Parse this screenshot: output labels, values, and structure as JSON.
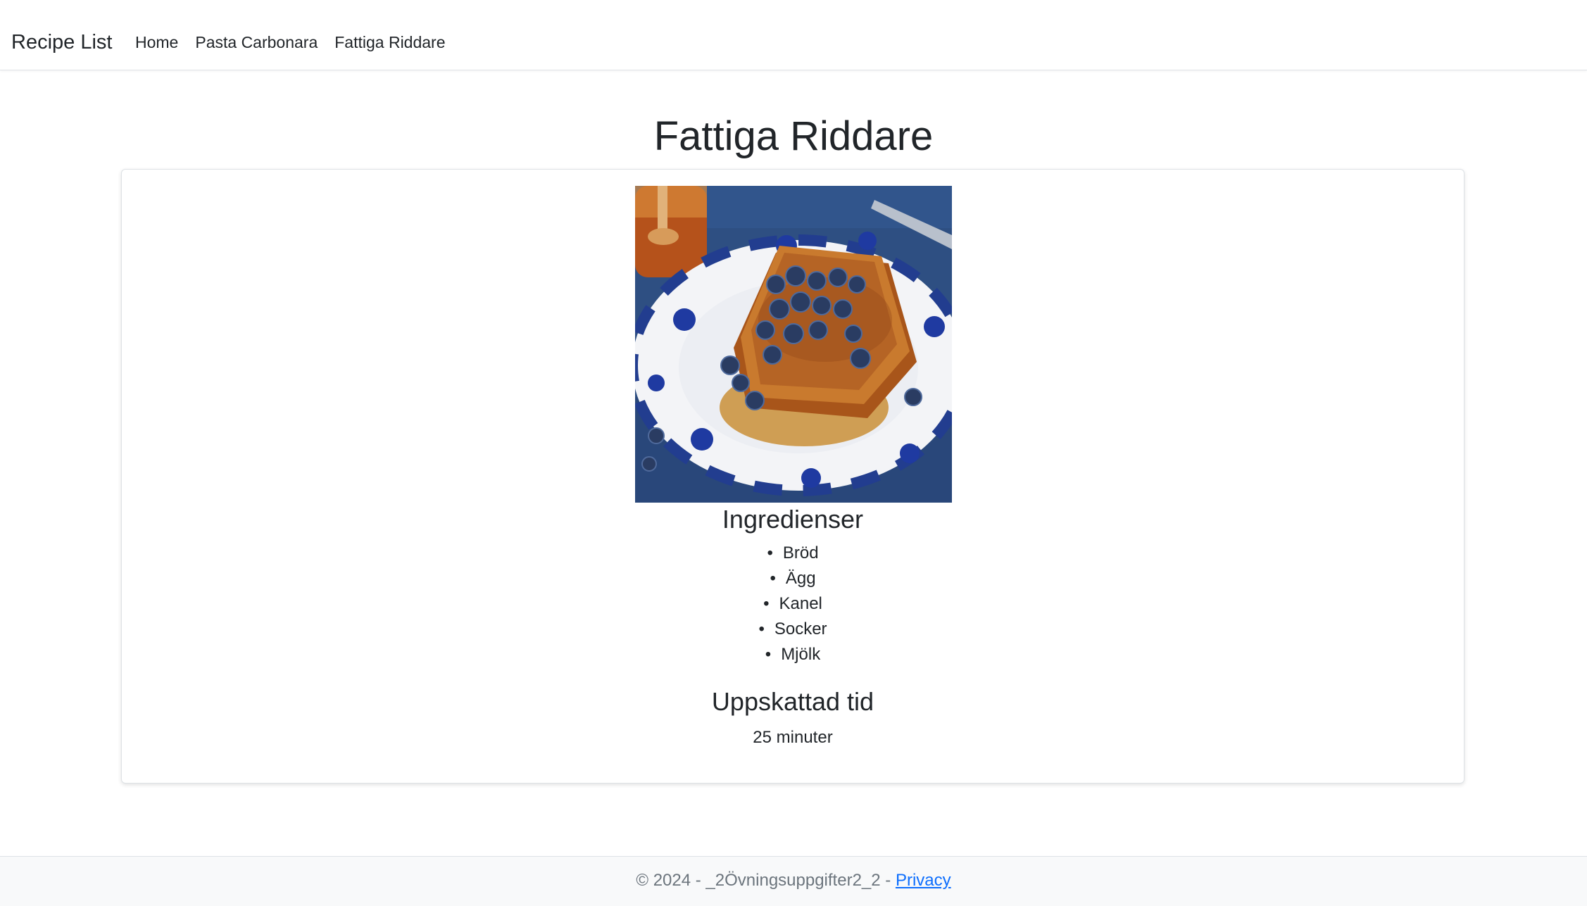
{
  "navbar": {
    "brand": "Recipe List",
    "links": [
      {
        "label": "Home"
      },
      {
        "label": "Pasta Carbonara"
      },
      {
        "label": "Fattiga Riddare"
      }
    ]
  },
  "recipe": {
    "title": "Fattiga Riddare",
    "ingredients_heading": "Ingredienser",
    "ingredients": [
      "Bröd",
      "Ägg",
      "Kanel",
      "Socker",
      "Mjölk"
    ],
    "time_heading": "Uppskattad tid",
    "time_value": "25 minuter"
  },
  "footer": {
    "text": "© 2024 - _2Övningsuppgifter2_2 - ",
    "privacy_label": "Privacy"
  },
  "colors": {
    "link_blue": "#0d6efd",
    "text_dark": "#212529",
    "footer_bg": "#f8f9fa",
    "border": "#dee2e6"
  }
}
